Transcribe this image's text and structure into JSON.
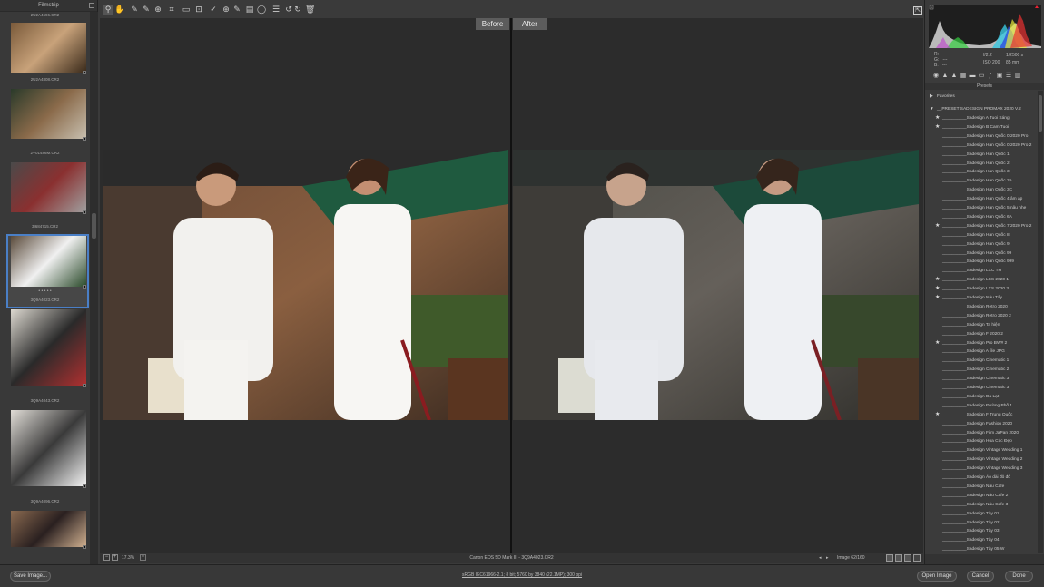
{
  "filmstrip": {
    "title": "Filmstrip",
    "items": [
      {
        "top_label": "2U2A4696.CR2",
        "bottom_label": "2U2A4808.CR2"
      },
      {
        "top_label": "",
        "bottom_label": "2V01486M.CR2"
      },
      {
        "top_label": "",
        "bottom_label": "3I684715.CR2"
      },
      {
        "top_label": "",
        "bottom_label": "3Q9A4023.CR2",
        "selected": true,
        "dots": "• • • • •"
      },
      {
        "top_label": "",
        "bottom_label": "3Q9A4043.CR2"
      },
      {
        "top_label": "",
        "bottom_label": "3Q9A4096.CR2"
      },
      {
        "top_label": "",
        "bottom_label": ""
      }
    ]
  },
  "toolbar": {
    "tools": [
      "zoom-icon",
      "hand-icon",
      "white-balance-icon",
      "color-sampler-icon",
      "target-adjust-icon",
      "crop-icon",
      "straighten-icon",
      "transform-icon",
      "spot-removal-icon",
      "red-eye-icon",
      "adjustment-brush-icon",
      "graduated-filter-icon",
      "radial-filter-icon",
      "preferences-icon",
      "rotate-left-icon",
      "rotate-right-icon",
      "trash-icon"
    ],
    "glyphs": [
      "⚲",
      "✋",
      "✎",
      "✎",
      "⊕",
      "⌗",
      "▭",
      "⊡",
      "✓",
      "⊕",
      "✎",
      "▤",
      "◯",
      "☰",
      "↺",
      "↻",
      "🗑"
    ]
  },
  "canvas": {
    "before_label": "Before",
    "after_label": "After"
  },
  "status": {
    "zoom": "17.3%",
    "camera": "Canon EOS 5D Mark III  -  3Q9A4023.CR2",
    "image_count": "Image 62/160"
  },
  "histogram": {
    "rgb_labels": "R:   ---\nG:   ---\nB:   ---",
    "fstop": "f/2.2",
    "shutter": "1/2500 s",
    "iso": "ISO 200",
    "lens": "85 mm"
  },
  "presets": {
    "title": "Presets",
    "favorites": "Favorites",
    "group": "__PRESET SADESIGN PROMAX 2020 V.2",
    "items": [
      {
        "label": "__________Sadesign A Tuoi Sáng",
        "star": true
      },
      {
        "label": "__________Sadesign B  Cam Tuoi",
        "star": true
      },
      {
        "label": "__________Sadesign Hàn Quốc 0 2020 Pro",
        "star": false
      },
      {
        "label": "__________Sadesign Hàn Quốc 0 2020 Pro 2",
        "star": false
      },
      {
        "label": "__________Sadesign Hàn Quốc 1",
        "star": false
      },
      {
        "label": "__________Sadesign Hàn Quốc 2",
        "star": false
      },
      {
        "label": "__________Sadesign Hàn Quốc 3",
        "star": false
      },
      {
        "label": "__________Sadesign Hàn Quốc 3A",
        "star": false
      },
      {
        "label": "__________Sadesign Hàn Quốc 3C",
        "star": false
      },
      {
        "label": "__________Sadesign Hàn Quốc 4 âm áp",
        "star": false
      },
      {
        "label": "__________Sadesign Hàn Quốc 5 nâu nhe",
        "star": false
      },
      {
        "label": "__________Sadesign Hàn Quốc 6A",
        "star": false
      },
      {
        "label": "__________Sadesign Hàn Quốc 7 2020 Pro 2",
        "star": true
      },
      {
        "label": "__________Sadesign Hàn Quốc 8",
        "star": false
      },
      {
        "label": "__________Sadesign Hàn Quốc 9",
        "star": false
      },
      {
        "label": "__________Sadesign Hàn Quốc 99",
        "star": false
      },
      {
        "label": "__________Sadesign Hàn Quốc 999",
        "star": false
      },
      {
        "label": "__________Sadesign LXC  TH",
        "star": false
      },
      {
        "label": "__________Sadesign LXS 2020 1",
        "star": true
      },
      {
        "label": "__________Sadesign LXS 2020 3",
        "star": true
      },
      {
        "label": "__________Sadesign Nâu Tây",
        "star": true
      },
      {
        "label": "__________Sadesign Retro 2020",
        "star": false
      },
      {
        "label": "__________Sadesign Retro 2020 2",
        "star": false
      },
      {
        "label": "__________Sadesign Ta hiện",
        "star": false
      },
      {
        "label": "__________Sadesign  F 2020 2",
        "star": false
      },
      {
        "label": "__________Sadesign  Pro BW# 2",
        "star": true
      },
      {
        "label": "__________Sadesign  A file JPG",
        "star": false
      },
      {
        "label": "__________Sadesign Cinematic 1",
        "star": false
      },
      {
        "label": "__________Sadesign Cinematic 2",
        "star": false
      },
      {
        "label": "__________Sadesign Cinematic 3",
        "star": false
      },
      {
        "label": "__________Sadesign Cinematic 3",
        "star": false
      },
      {
        "label": "__________Sadesign Đà Lạt",
        "star": false
      },
      {
        "label": "__________Sadesign Đường Phố 1",
        "star": false
      },
      {
        "label": "__________Sadesign F Trung Quốc",
        "star": true
      },
      {
        "label": "__________Sadesign Fashion 2020",
        "star": false
      },
      {
        "label": "__________Sadesign Film JaPan 2020",
        "star": false
      },
      {
        "label": "__________Sadesign Hoa Cúc Đẹp",
        "star": false
      },
      {
        "label": "__________Sadesign Vintage Wedding 1",
        "star": false
      },
      {
        "label": "__________Sadesign Vintage Wedding 2",
        "star": false
      },
      {
        "label": "__________Sadesign Vintage Wedding 3",
        "star": false
      },
      {
        "label": "__________Sadesign Áo dài đỏ đỏ",
        "star": false
      },
      {
        "label": "__________Sadesign Nâu Cafe",
        "star": false
      },
      {
        "label": "__________Sadesign Nâu Cafe 2",
        "star": false
      },
      {
        "label": "__________Sadesign Nâu Cafe 3",
        "star": false
      },
      {
        "label": "__________Sadesign Tây 01",
        "star": false
      },
      {
        "label": "__________Sadesign Tây 02",
        "star": false
      },
      {
        "label": "__________Sadesign Tây 03",
        "star": false
      },
      {
        "label": "__________Sadesign Tây 04",
        "star": false
      },
      {
        "label": "__________Sadesign Tây 05 W",
        "star": false
      }
    ]
  },
  "footer": {
    "save": "Save Image...",
    "workflow": "sRGB IEC61966-2.1; 8 bit; 5760 by 3840 (22.1MP); 300 ppi",
    "open": "Open Image",
    "cancel": "Cancel",
    "done": "Done"
  },
  "colors": {
    "selection": "#4a7fc6",
    "background": "#3a3a3a",
    "canvas": "#2c2c2c"
  }
}
